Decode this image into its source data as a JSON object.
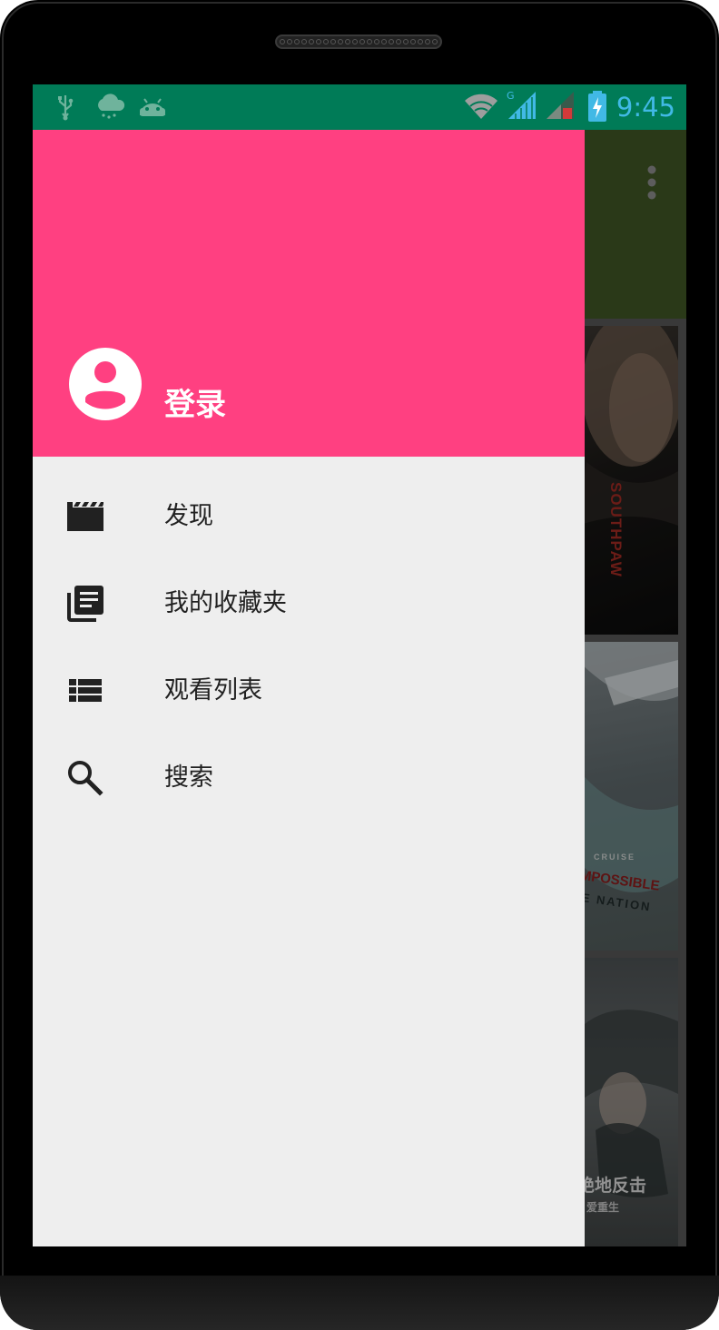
{
  "status_bar": {
    "time": "9:45",
    "left_icons": [
      "usb-icon",
      "weather-icon",
      "android-icon"
    ],
    "right_icons": [
      "wifi-icon",
      "signal-icon",
      "signal-no-sim-icon",
      "battery-charging-icon"
    ],
    "network_type": "G",
    "background_color": "#007b57",
    "time_color": "#41b9e5"
  },
  "drawer": {
    "header": {
      "background_color": "#ff4081",
      "login_label": "登录"
    },
    "menu": [
      {
        "label": "发现",
        "icon": "movie-icon"
      },
      {
        "label": "我的收藏夹",
        "icon": "library-books-icon"
      },
      {
        "label": "观看列表",
        "icon": "view-list-icon"
      },
      {
        "label": "搜索",
        "icon": "search-icon"
      }
    ]
  },
  "background_app": {
    "toolbar_color": "#3f5424",
    "posters": [
      {
        "text": "SOUTHPAW"
      },
      {
        "text": "IMPOSSIBLE",
        "extra": [
          "CRUISE",
          "E NATION"
        ]
      },
      {
        "text": "绝地反击",
        "extra": [
          "爱重生"
        ]
      }
    ]
  }
}
